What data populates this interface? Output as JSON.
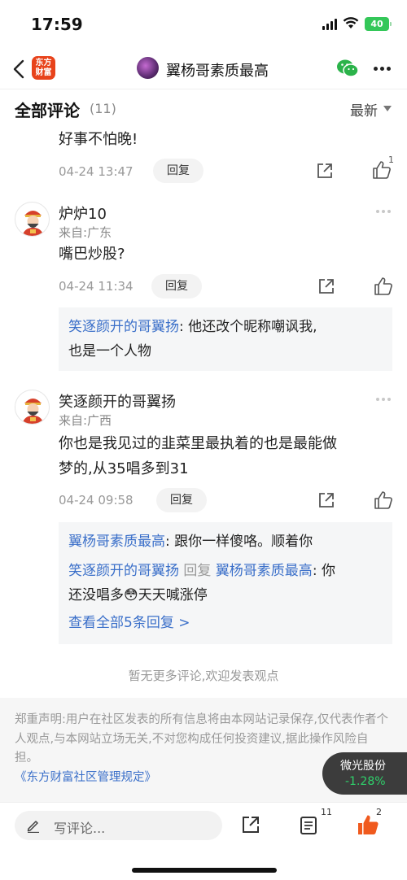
{
  "status_bar": {
    "time": "17:59",
    "battery": "40"
  },
  "nav": {
    "brand_line1": "东方",
    "brand_line2": "财富",
    "title": "翼杨哥素质最高"
  },
  "section": {
    "title": "全部评论",
    "count": "(11)",
    "sort_label": "最新"
  },
  "comments": [
    {
      "text": "好事不怕晚!",
      "date": "04-24 13:47",
      "reply_label": "回复",
      "like_count": "1"
    },
    {
      "name": "炉炉10",
      "location": "来自:广东",
      "text": "嘴巴炒股?",
      "date": "04-24 11:34",
      "reply_label": "回复",
      "replies": [
        {
          "author": "笑逐颜开的哥翼扬",
          "sep": ":",
          "line1": " 他还改个昵称嘲讽我,",
          "line2": "也是一个人物"
        }
      ]
    },
    {
      "name": "笑逐颜开的哥翼扬",
      "location": "来自:广西",
      "text_line1": "你也是我见过的韭菜里最执着的也是最能做",
      "text_line2": "梦的,从35唱多到31",
      "date": "04-24 09:58",
      "reply_label": "回复",
      "replies": [
        {
          "author": "翼杨哥素质最高",
          "sep": ":",
          "text": " 跟你一样傻咯。顺着你"
        },
        {
          "author": "笑逐颜开的哥翼扬",
          "reply_word": " 回复 ",
          "target": "翼杨哥素质最高",
          "sep": ":",
          "text1": " 你",
          "text2a": "还没唱多",
          "emoji": "😳",
          "text2b": "天天喊涨停"
        }
      ],
      "view_all": "查看全部5条回复 >"
    }
  ],
  "no_more": "暂无更多评论,欢迎发表观点",
  "disclaimer": {
    "text": "郑重声明:用户在社区发表的所有信息将由本网站记录保存,仅代表作者个人观点,与本网站立场无关,不对您构成任何投资建议,据此操作风险自担。",
    "link": "《东方财富社区管理规定》"
  },
  "stock": {
    "name": "微光股份",
    "change": "-1.28%"
  },
  "bottom_bar": {
    "placeholder": "写评论...",
    "list_count": "11",
    "like_count": "2"
  },
  "colors": {
    "brand": "#e8431b",
    "link": "#3a6fc9",
    "stock_down": "#2fd16b",
    "like": "#f05a1e"
  }
}
